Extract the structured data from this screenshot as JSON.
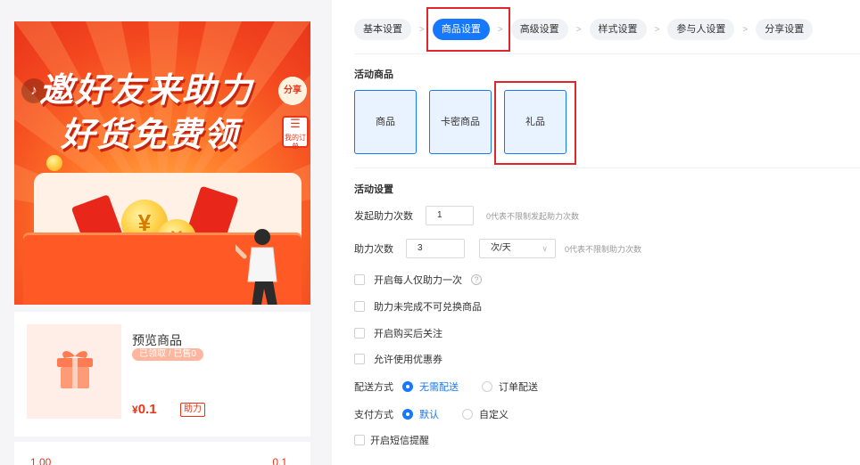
{
  "preview": {
    "banner": {
      "title_line1": "邀好友来助力",
      "title_line2": "好货免费领",
      "share_label": "分享",
      "order_label": "我的订单",
      "music_icon": "music-note-icon",
      "coin_symbol": "¥"
    },
    "product": {
      "name": "预览商品",
      "tags": "已领取 / 已售0",
      "currency": "¥",
      "price": "0.1",
      "help_tag": "助力"
    },
    "bottom": {
      "left_value": "1.00",
      "right_value": "0.1"
    }
  },
  "tabs": [
    {
      "label": "基本设置",
      "active": false
    },
    {
      "label": "商品设置",
      "active": true
    },
    {
      "label": "高级设置",
      "active": false
    },
    {
      "label": "样式设置",
      "active": false
    },
    {
      "label": "参与人设置",
      "active": false
    },
    {
      "label": "分享设置",
      "active": false
    }
  ],
  "tab_separator": ">",
  "activity_goods": {
    "title": "活动商品",
    "types": [
      "商品",
      "卡密商品",
      "礼品"
    ]
  },
  "activity_settings": {
    "title": "活动设置",
    "initiate_label": "发起助力次数",
    "initiate_value": "1",
    "initiate_hint": "0代表不限制发起助力次数",
    "help_label": "助力次数",
    "help_value": "3",
    "help_unit": "次/天",
    "help_hint": "0代表不限制助力次数",
    "checkbox_once": "开启每人仅助力一次",
    "checkbox_exchange": "助力未完成不可兑换商品",
    "checkbox_follow": "开启购买后关注",
    "checkbox_coupon": "允许使用优惠券",
    "delivery_label": "配送方式",
    "delivery_options": [
      "无需配送",
      "订单配送"
    ],
    "delivery_selected": "无需配送",
    "pay_label": "支付方式",
    "pay_options": [
      "默认",
      "自定义"
    ],
    "pay_selected": "默认",
    "checkbox_sms": "开启短信提醒"
  },
  "colors": {
    "accent": "#1677ff",
    "highlight": "#e0262a",
    "price": "#e8351a"
  }
}
